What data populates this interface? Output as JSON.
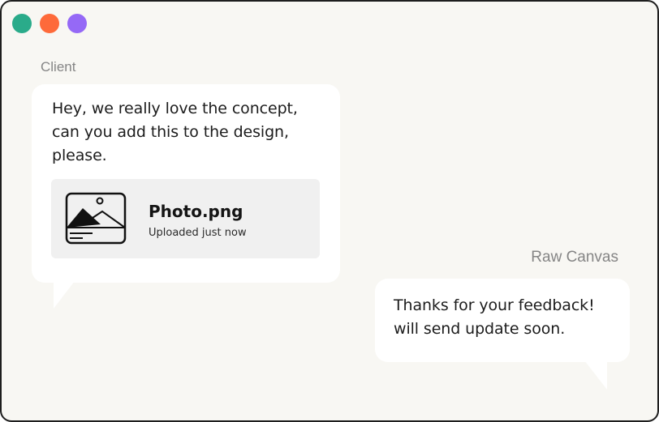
{
  "window": {
    "controls": [
      {
        "name": "green",
        "color": "#2aab8a"
      },
      {
        "name": "orange",
        "color": "#fe6a3a"
      },
      {
        "name": "purple",
        "color": "#9569f6"
      }
    ]
  },
  "chat": {
    "client": {
      "sender": "Client",
      "message_lines": [
        "Hey, we really love the concept,",
        "can you add this to the design,",
        "please."
      ],
      "attachment": {
        "icon": "image-icon",
        "filename": "Photo.png",
        "status": "Uploaded just now"
      }
    },
    "reply": {
      "sender": "Raw Canvas",
      "message_lines": [
        "Thanks for your feedback!",
        "will send update soon."
      ]
    }
  }
}
